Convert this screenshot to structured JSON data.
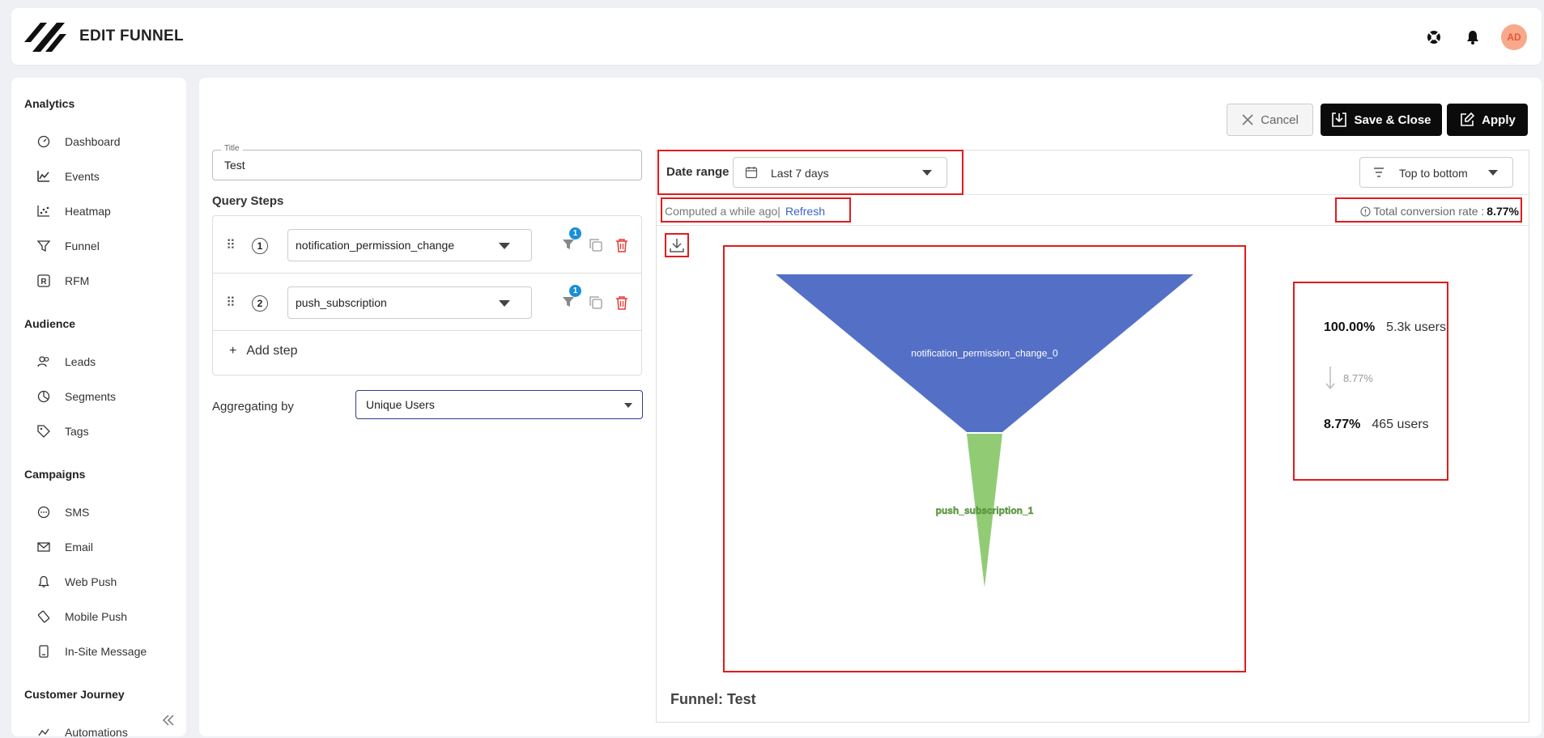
{
  "app": {
    "title": "EDIT FUNNEL",
    "avatar_initials": "AD"
  },
  "sidebar": {
    "sections": [
      {
        "label": "Analytics",
        "items": [
          "Dashboard",
          "Events",
          "Heatmap",
          "Funnel",
          "RFM"
        ]
      },
      {
        "label": "Audience",
        "items": [
          "Leads",
          "Segments",
          "Tags"
        ]
      },
      {
        "label": "Campaigns",
        "items": [
          "SMS",
          "Email",
          "Web Push",
          "Mobile Push",
          "In-Site Message"
        ]
      },
      {
        "label": "Customer Journey",
        "items": [
          "Automations"
        ]
      }
    ]
  },
  "actions": {
    "cancel": "Cancel",
    "save_close": "Save & Close",
    "apply": "Apply"
  },
  "form": {
    "title_label": "Title",
    "title_value": "Test",
    "query_steps_heading": "Query Steps",
    "steps": [
      {
        "number": "1",
        "event": "notification_permission_change",
        "filter_count": "1"
      },
      {
        "number": "2",
        "event": "push_subscription",
        "filter_count": "1"
      }
    ],
    "add_step": "Add step",
    "aggregating_label": "Aggregating by",
    "aggregating_value": "Unique Users"
  },
  "panel": {
    "date_range_label": "Date range",
    "date_range_value": "Last 7 days",
    "order_value": "Top to bottom",
    "computed_text": "Computed a while ago|",
    "refresh": "Refresh",
    "total_conversion_label": "Total conversion rate :",
    "total_conversion_value": "8.77%",
    "funnel_caption": "Funnel: Test"
  },
  "chart_data": {
    "type": "funnel",
    "stages": [
      {
        "name": "notification_permission_change_0",
        "percent": "100.00%",
        "users": "5.3k users",
        "color": "#5470c6"
      },
      {
        "name": "push_subscription_1",
        "percent": "8.77%",
        "users": "465 users",
        "color": "#91cc75"
      }
    ],
    "step_conversion": "8.77%"
  },
  "colors": {
    "accent_red": "#e21b1b",
    "link_blue": "#3b62c9",
    "badge_blue": "#1a8fd8",
    "delete_red": "#e53935"
  }
}
